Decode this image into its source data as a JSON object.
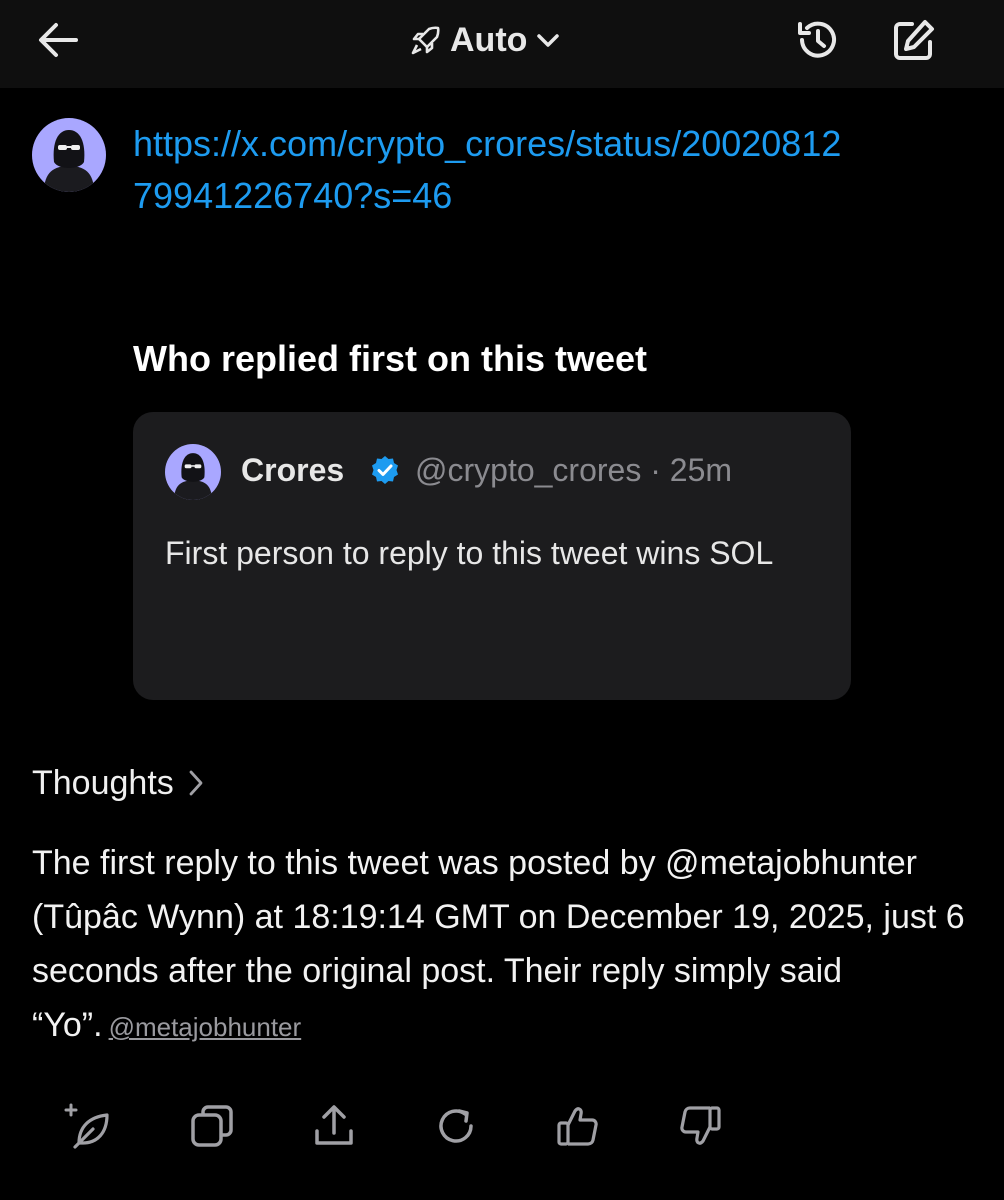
{
  "header": {
    "mode_label": "Auto",
    "icons": [
      "back-arrow-icon",
      "rocket-icon",
      "chevron-down-icon",
      "history-icon",
      "edit-icon"
    ]
  },
  "user_message": {
    "link": "https://x.com/crypto_crores/status/2002081279941226740?s=46",
    "question": "Who replied first on this tweet"
  },
  "tweet_card": {
    "name": "Crores",
    "handle_time": "@crypto_crores · 25m",
    "text": "First person to reply to this tweet wins SOL",
    "colors": {
      "background": "#1c1c1e",
      "verified": "#1d9bf0"
    }
  },
  "response": {
    "thoughts_label": "Thoughts",
    "text": "The first reply to this tweet was posted by @metajobhunter (Tûpâc Wynn) at 18:19:14 GMT on December 19, 2025, just 6 seconds after the original post. Their reply simply said “Yo”.",
    "citation": "@metajobhunter"
  },
  "actions": {
    "icons": [
      "sparkle-leaf-icon",
      "copy-icon",
      "share-icon",
      "regenerate-icon",
      "thumbs-up-icon",
      "thumbs-down-icon"
    ]
  },
  "colors": {
    "link": "#1d9bf0",
    "background": "#000000",
    "topbar": "#0f0f0f"
  }
}
